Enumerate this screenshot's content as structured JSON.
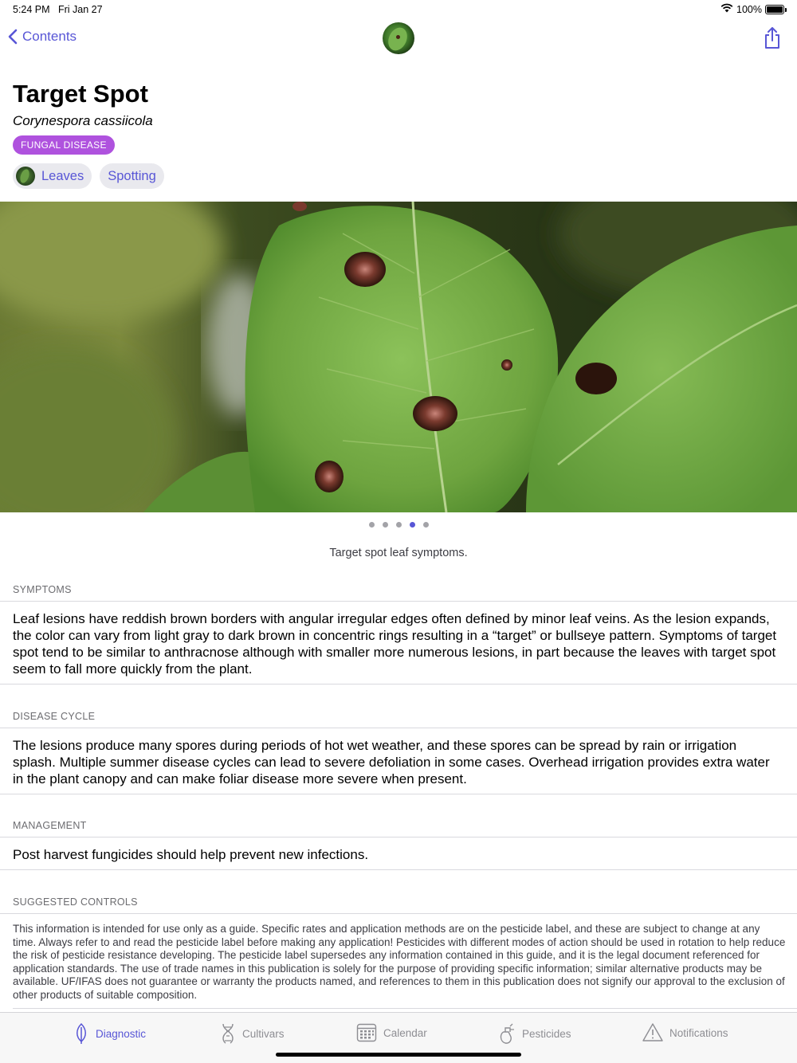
{
  "status_bar": {
    "time": "5:24 PM",
    "date": "Fri Jan 27",
    "battery": "100%"
  },
  "nav": {
    "back_label": "Contents",
    "avatar_icon": "leaf-thumbnail",
    "share_icon": "share-icon"
  },
  "header": {
    "title": "Target Spot",
    "scientific_name": "Corynespora cassiicola",
    "badge": "FUNGAL DISEASE",
    "badge_color": "#af52de",
    "chips": [
      {
        "label": "Leaves"
      },
      {
        "label": "Spotting"
      }
    ]
  },
  "gallery": {
    "page_count": 5,
    "current_page": 4,
    "caption": "Target spot leaf symptoms."
  },
  "sections": {
    "symptoms": {
      "header": "SYMPTOMS",
      "text": "Leaf lesions have reddish brown borders with angular irregular edges often defined by minor leaf veins. As the lesion expands, the color can vary from light gray to dark brown in concentric rings resulting in a “target” or bullseye pattern. Symptoms of target spot tend to be similar to anthracnose although with smaller more numerous lesions, in part because the leaves with target spot seem to fall more quickly from the plant."
    },
    "disease_cycle": {
      "header": "DISEASE CYCLE",
      "text": "The lesions produce many spores during periods of hot wet weather, and these spores can be spread by rain or irrigation splash. Multiple summer disease cycles can lead to severe defoliation in some cases. Overhead irrigation provides extra water in the plant canopy and can make foliar disease more severe when present."
    },
    "management": {
      "header": "MANAGEMENT",
      "text": "Post harvest fungicides should help prevent new infections."
    },
    "suggested_controls": {
      "header": "SUGGESTED CONTROLS",
      "text": "This information is intended for use only as a guide. Specific rates and application methods are on the pesticide label, and these are subject to change at any time. Always refer to and read the pesticide label before making any application! Pesticides with different modes of action should be used in rotation to help reduce the risk of pesticide resistance developing. The pesticide label supersedes any information contained in this guide, and it is the legal document referenced for application standards. The use of trade names in this publication is solely for the purpose of providing specific information; similar alternative products may be available. UF/IFAS does not guarantee or warranty the products named, and references to them in this publication does not signify our approval to the exclusion of other products of suitable composition."
    }
  },
  "tab_bar": {
    "active": "Diagnostic",
    "accent_color": "#5856d6",
    "tabs": [
      {
        "label": "Diagnostic",
        "icon": "leaf-icon"
      },
      {
        "label": "Cultivars",
        "icon": "dna-icon"
      },
      {
        "label": "Calendar",
        "icon": "calendar-icon"
      },
      {
        "label": "Pesticides",
        "icon": "spray-icon"
      },
      {
        "label": "Notifications",
        "icon": "warning-icon"
      }
    ]
  }
}
